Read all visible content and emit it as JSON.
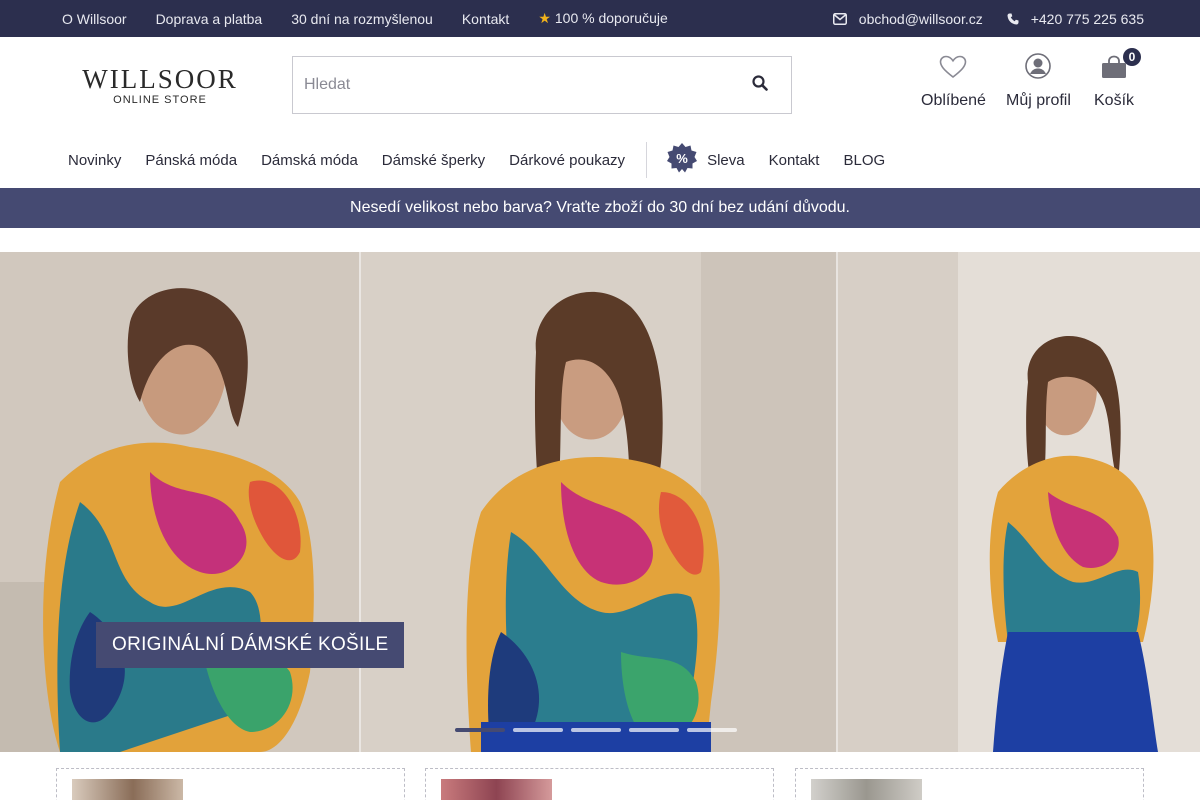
{
  "topbar": {
    "links": [
      "O Willsoor",
      "Doprava a platba",
      "30 dní na rozmyšlenou",
      "Kontakt"
    ],
    "recommend_label": "100 % doporučuje",
    "email": "obchod@willsoor.cz",
    "phone": "+420 775 225 635"
  },
  "logo": {
    "wordmark": "WILLSOOR",
    "subtitle": "ONLINE STORE"
  },
  "search": {
    "placeholder": "Hledat",
    "value": ""
  },
  "header_icons": {
    "favorites_label": "Oblíbené",
    "profile_label": "Můj profil",
    "cart_label": "Košík",
    "cart_count": "0"
  },
  "nav": {
    "items_left": [
      "Novinky",
      "Pánská móda",
      "Dámská móda",
      "Dámské šperky",
      "Dárkové poukazy"
    ],
    "sale_label": "Sleva",
    "items_right": [
      "Kontakt",
      "BLOG"
    ]
  },
  "banner_strip": {
    "text": "Nesedí velikost nebo barva? Vraťte zboží do 30 dní bez udání důvodu."
  },
  "hero": {
    "caption": "ORIGINÁLNÍ DÁMSKÉ KOŠILE",
    "slide_count": 5,
    "active_slide": 1
  },
  "colors": {
    "topbar_bg": "#2c2f4e",
    "accent": "#454a72",
    "star": "#f1b21b"
  }
}
